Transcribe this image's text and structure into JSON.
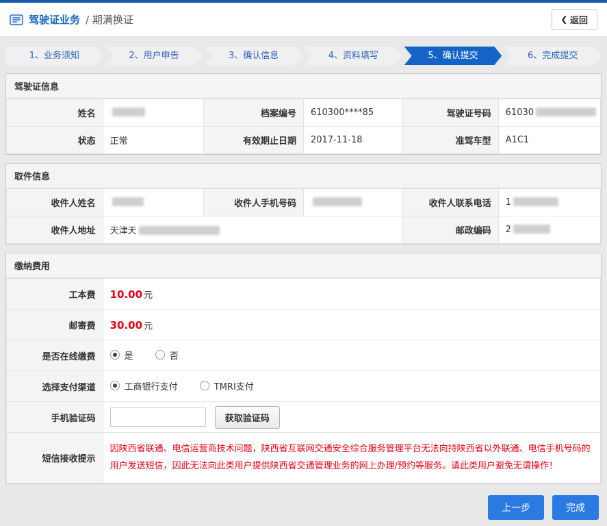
{
  "header": {
    "title": "驾驶证业务",
    "subtitle": "/ 期满换证",
    "back_chevron": "❮",
    "back_label": "返回"
  },
  "steps": [
    {
      "label": "1、业务须知",
      "active": false
    },
    {
      "label": "2、用户申告",
      "active": false
    },
    {
      "label": "3、确认信息",
      "active": false
    },
    {
      "label": "4、资料填写",
      "active": false
    },
    {
      "label": "5、确认提交",
      "active": true
    },
    {
      "label": "6、完成提交",
      "active": false
    }
  ],
  "license": {
    "title": "驾驶证信息",
    "rows": [
      [
        {
          "label": "姓名",
          "value": "",
          "redacted": true
        },
        {
          "label": "档案编号",
          "value": "610300****85",
          "redacted": false
        },
        {
          "label": "驾驶证号码",
          "value": "61030",
          "redacted": true
        }
      ],
      [
        {
          "label": "状态",
          "value": "正常"
        },
        {
          "label": "有效期止日期",
          "value": "2017-11-18"
        },
        {
          "label": "准驾车型",
          "value": "A1C1"
        }
      ]
    ]
  },
  "pickup": {
    "title": "取件信息",
    "rows": [
      [
        {
          "label": "收件人姓名",
          "value": "",
          "redacted": true
        },
        {
          "label": "收件人手机号码",
          "value": "",
          "redacted": true
        },
        {
          "label": "收件人联系电话",
          "value": "1",
          "redacted": true
        }
      ],
      [
        {
          "label": "收件人地址",
          "value": "天津天",
          "redacted": true
        },
        {
          "label": "邮政编码",
          "value": "2",
          "redacted": true
        }
      ]
    ]
  },
  "fees": {
    "title": "缴纳费用",
    "cost_rows": [
      {
        "label": "工本费",
        "amount": "10.00",
        "unit": "元"
      },
      {
        "label": "邮寄费",
        "amount": "30.00",
        "unit": "元"
      }
    ],
    "online_pay": {
      "label": "是否在线缴费",
      "options": [
        {
          "label": "是",
          "checked": true
        },
        {
          "label": "否",
          "checked": false
        }
      ]
    },
    "channel": {
      "label": "选择支付渠道",
      "options": [
        {
          "label": "工商银行支付",
          "checked": true
        },
        {
          "label": "TMRI支付",
          "checked": false
        }
      ]
    },
    "captcha": {
      "label": "手机验证码",
      "input_value": "",
      "button_label": "获取验证码"
    },
    "sms_notice": {
      "label": "短信接收提示",
      "text": "因陕西省联通、电信运营商技术问题，陕西省互联网交通安全综合服务管理平台无法向持陕西省以外联通、电信手机号码的用户发送短信，因此无法向此类用户提供陕西省交通管理业务的网上办理/预约等服务。请此类用户避免无谓操作！"
    }
  },
  "footer": {
    "prev_label": "上一步",
    "done_label": "完成"
  }
}
